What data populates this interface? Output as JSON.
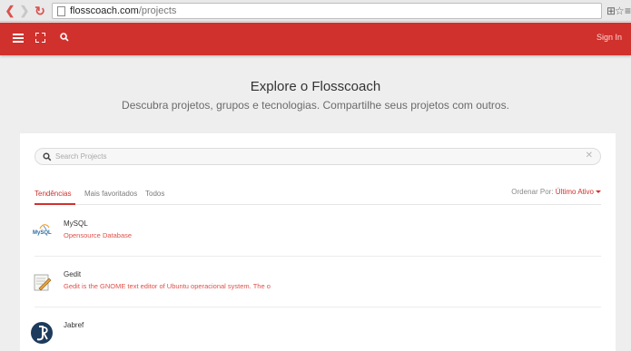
{
  "browser": {
    "url_host": "flosscoach.com",
    "url_path": "/projects"
  },
  "header": {
    "signin_label": "Sign In"
  },
  "hero": {
    "title": "Explore o Flosscoach",
    "subtitle": "Descubra projetos, grupos e tecnologias. Compartilhe seus projetos com outros."
  },
  "search": {
    "placeholder": "Search Projects",
    "value": ""
  },
  "tabs": [
    {
      "label": "Tendências",
      "active": true
    },
    {
      "label": "Mais favoritados",
      "active": false
    },
    {
      "label": "Todos",
      "active": false
    }
  ],
  "sort": {
    "label": "Ordenar Por:",
    "value": "Último Ativo"
  },
  "projects": [
    {
      "name": "MySQL",
      "description": "Opensource Database",
      "logo_text": "MySQL"
    },
    {
      "name": "Gedit",
      "description": "Gedit is the GNOME text editor of Ubuntu operacional system. The o"
    },
    {
      "name": "Jabref",
      "description": ""
    }
  ],
  "colors": {
    "brand": "#d0312d",
    "link": "#e0504a"
  }
}
